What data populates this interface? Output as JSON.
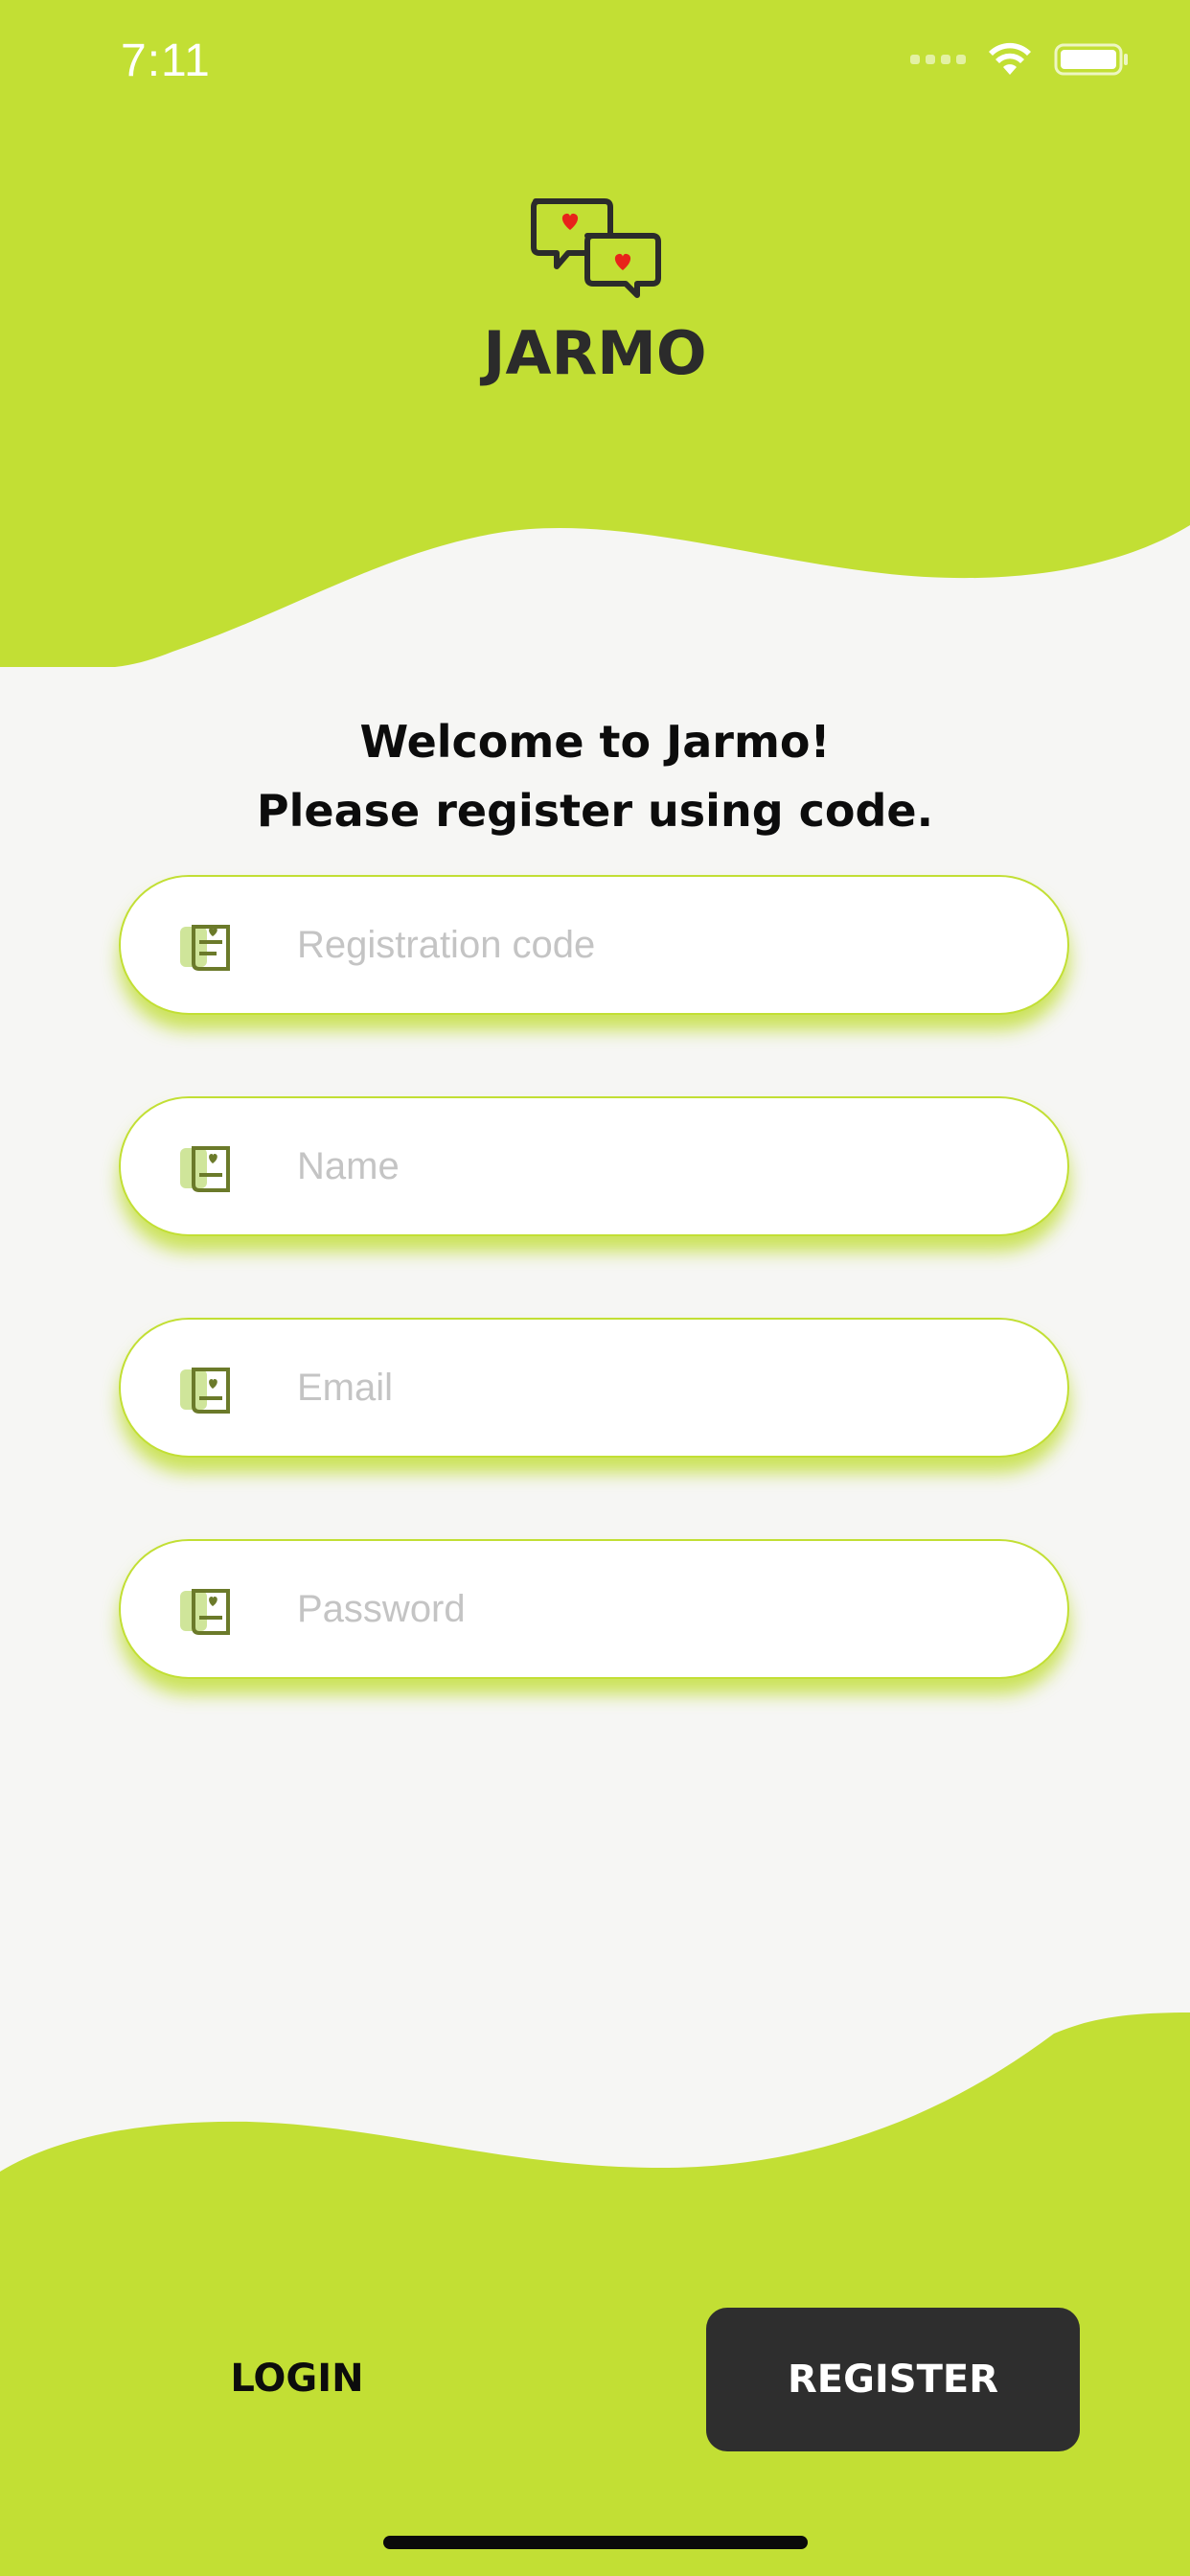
{
  "colors": {
    "accent": "#c2df34",
    "background": "#f6f6f4",
    "dark_button": "#2e2e2e",
    "heart": "#e8231a"
  },
  "status_bar": {
    "time": "7:11",
    "icons": [
      "cellular-signal-icon",
      "wifi-icon",
      "battery-icon"
    ]
  },
  "header": {
    "logo_icon": "chat-bubbles-hearts-icon",
    "brand": "JARMO"
  },
  "welcome": {
    "line1": "Welcome to Jarmo!",
    "line2": "Please register using code."
  },
  "form": {
    "fields": [
      {
        "icon": "code-icon",
        "placeholder": "Registration code",
        "value": ""
      },
      {
        "icon": "user-icon",
        "placeholder": "Name",
        "value": ""
      },
      {
        "icon": "email-icon",
        "placeholder": "Email",
        "value": ""
      },
      {
        "icon": "lock-icon",
        "placeholder": "Password",
        "value": ""
      }
    ]
  },
  "footer": {
    "login_label": "LOGIN",
    "register_label": "REGISTER"
  }
}
